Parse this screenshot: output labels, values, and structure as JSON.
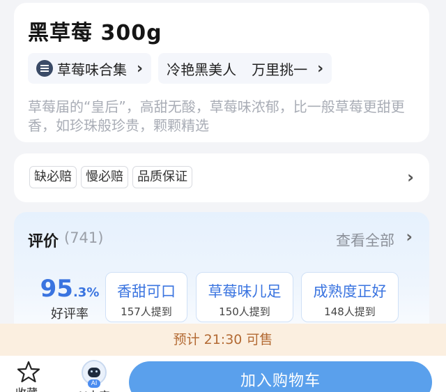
{
  "product": {
    "title": "黑草莓 300g",
    "collection_label": "草莓味合集",
    "feature_tags": [
      "冷艳黑美人",
      "万里挑一"
    ],
    "description": "草莓届的“皇后”，高甜无酸，草莓味浓郁，比一般草莓更甜更香，如珍珠般珍贵，颗颗精选"
  },
  "guarantees": [
    "缺必赔",
    "慢必赔",
    "品质保证"
  ],
  "reviews": {
    "title": "评价",
    "count": "(741)",
    "view_all": "查看全部",
    "rating_value": "95",
    "rating_pct": ".3%",
    "rating_label": "好评率",
    "keywords": [
      {
        "text": "香甜可口",
        "mentions": "157人提到"
      },
      {
        "text": "草莓味儿足",
        "mentions": "150人提到"
      },
      {
        "text": "成熟度正好",
        "mentions": "148人提到"
      }
    ]
  },
  "sale_notice": "预计 21:30 可售",
  "bottom_bar": {
    "favorite_label": "收藏",
    "ai_label": "AI小店",
    "ai_badge": "AI",
    "add_to_cart": "加入购物车"
  },
  "colors": {
    "accent_blue": "#3a74e0",
    "cart_button": "#5aa0ec",
    "banner_bg": "#fbefe0",
    "banner_text": "#b36a33"
  },
  "icons": [
    "collection-icon",
    "chevron-right-icon",
    "star-icon",
    "ai-assistant-icon"
  ]
}
